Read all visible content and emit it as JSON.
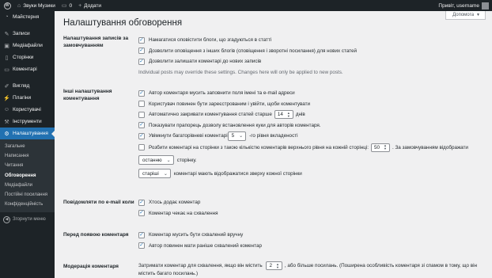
{
  "adminbar": {
    "site_name": "Звуки Музики",
    "comments_count": "0",
    "new_label": "Додати",
    "greeting": "Привіт, username"
  },
  "sidebar": {
    "items": [
      {
        "label": "Майстерня",
        "icon": "dashboard-icon"
      },
      {
        "label": "Записи",
        "icon": "pin-icon"
      },
      {
        "label": "Медіафайли",
        "icon": "media-icon"
      },
      {
        "label": "Сторінки",
        "icon": "page-icon"
      },
      {
        "label": "Коментарі",
        "icon": "comment-icon"
      },
      {
        "label": "Вигляд",
        "icon": "brush-icon"
      },
      {
        "label": "Плагіни",
        "icon": "plugin-icon"
      },
      {
        "label": "Користувачі",
        "icon": "users-icon"
      },
      {
        "label": "Інструменти",
        "icon": "wrench-icon"
      },
      {
        "label": "Налаштування",
        "icon": "settings-icon"
      }
    ],
    "submenu": [
      "Загальне",
      "Написання",
      "Читання",
      "Обговорення",
      "Медіафайли",
      "Постійні посилання",
      "Конфіденційність"
    ],
    "collapse_label": "Згорнути меню"
  },
  "header": {
    "help_label": "Допомога",
    "title": "Налаштування обговорення"
  },
  "sections": {
    "defaults": {
      "heading": "Налаштування записів за замовчуванням",
      "options": [
        "Намагатися оповістити блоги, що згадуються в статті",
        "Дозволити оповіщення з інших блогів (сповіщення і зворотні посилання) для нових статей",
        "Дозволити залишати коментарі до нових записів"
      ],
      "note": "Individual posts may override these settings. Changes here will only be applied to new posts."
    },
    "other": {
      "heading": "Інші налаштування коментування",
      "opt_name_email": "Автор коментаря мусить заповнити поля імені та e-mail адреси",
      "opt_registered": "Користувач повинен бути зареєстрованим і увійти, щоби коментувати",
      "opt_autoclose_before": "Автоматично закривати коментування статей старше",
      "autoclose_days": "14",
      "opt_autoclose_after": "днів",
      "opt_cookies": "Показувати прапорець дозволу встановлення куки для авторів коментаря.",
      "opt_threaded_before": "Увімкнути багаторівневі коментарі",
      "thread_depth": "5",
      "opt_threaded_after": "-го рівня вкладеності",
      "opt_paged_before": "Розбити коментарі на сторінки з такою кількістю коментарів верхнього рівня на кожній сторінці:",
      "per_page": "50",
      "opt_paged_after": ". За замовчуванням відображати",
      "default_page": "останню",
      "default_page_after": "сторінку.",
      "order": "старіші",
      "order_after": "коментарі мають відображатися зверху кожної сторінки"
    },
    "email": {
      "heading": "Повідомляти по e-mail коли",
      "options": [
        "Хтось додає коментар",
        "Коментар чекає на схвалення"
      ]
    },
    "before": {
      "heading": "Перед появою коментаря",
      "options": [
        "Коментар мусить бути схвалений вручну",
        "Автор повинен мати раніше схвалений коментар"
      ]
    },
    "moderation": {
      "heading": "Модерація коментаря",
      "text_before": "Затримати коментар для схвалення, якщо він містить",
      "links_count": "2",
      "text_after": ", або більше посилань. (Поширена особливість коментаря зі спамом в тому, що він містить багато посилань.)"
    }
  },
  "colors": {
    "accent": "#2271b1",
    "sidebar": "#1d2327",
    "background": "#f0f0f1"
  }
}
